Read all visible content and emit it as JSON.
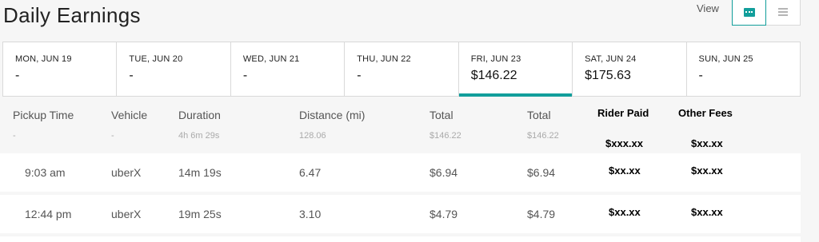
{
  "title": "Daily Earnings",
  "view": {
    "label": "View",
    "options": [
      "card-view",
      "list-view"
    ],
    "active": "card-view",
    "accent_color": "#129e9b"
  },
  "days": [
    {
      "name": "MON, JUN 19",
      "value": "-"
    },
    {
      "name": "TUE, JUN 20",
      "value": "-"
    },
    {
      "name": "WED, JUN 21",
      "value": "-"
    },
    {
      "name": "THU, JUN 22",
      "value": "-"
    },
    {
      "name": "FRI, JUN 23",
      "value": "$146.22",
      "selected": true
    },
    {
      "name": "SAT, JUN 24",
      "value": "$175.63"
    },
    {
      "name": "SUN, JUN 25",
      "value": "-"
    }
  ],
  "columns": {
    "pickup": "Pickup Time",
    "vehicle": "Vehicle",
    "duration": "Duration",
    "distance": "Distance (mi)",
    "total1": "Total",
    "total2": "Total",
    "rider_paid": "Rider Paid",
    "other_fees": "Other Fees"
  },
  "summary": {
    "pickup": "-",
    "vehicle": "-",
    "duration": "4h 6m 29s",
    "distance": "128.06",
    "total1": "$146.22",
    "total2": "$146.22",
    "rider_paid": "$xxx.xx",
    "other_fees": "$xx.xx"
  },
  "trips": [
    {
      "pickup": "9:03 am",
      "vehicle": "uberX",
      "duration": "14m 19s",
      "distance": "6.47",
      "total1": "$6.94",
      "total2": "$6.94",
      "rider_paid": "$xx.xx",
      "other_fees": "$xx.xx"
    },
    {
      "pickup": "12:44 pm",
      "vehicle": "uberX",
      "duration": "19m 25s",
      "distance": "3.10",
      "total1": "$4.79",
      "total2": "$4.79",
      "rider_paid": "$xx.xx",
      "other_fees": "$xx.xx"
    }
  ]
}
